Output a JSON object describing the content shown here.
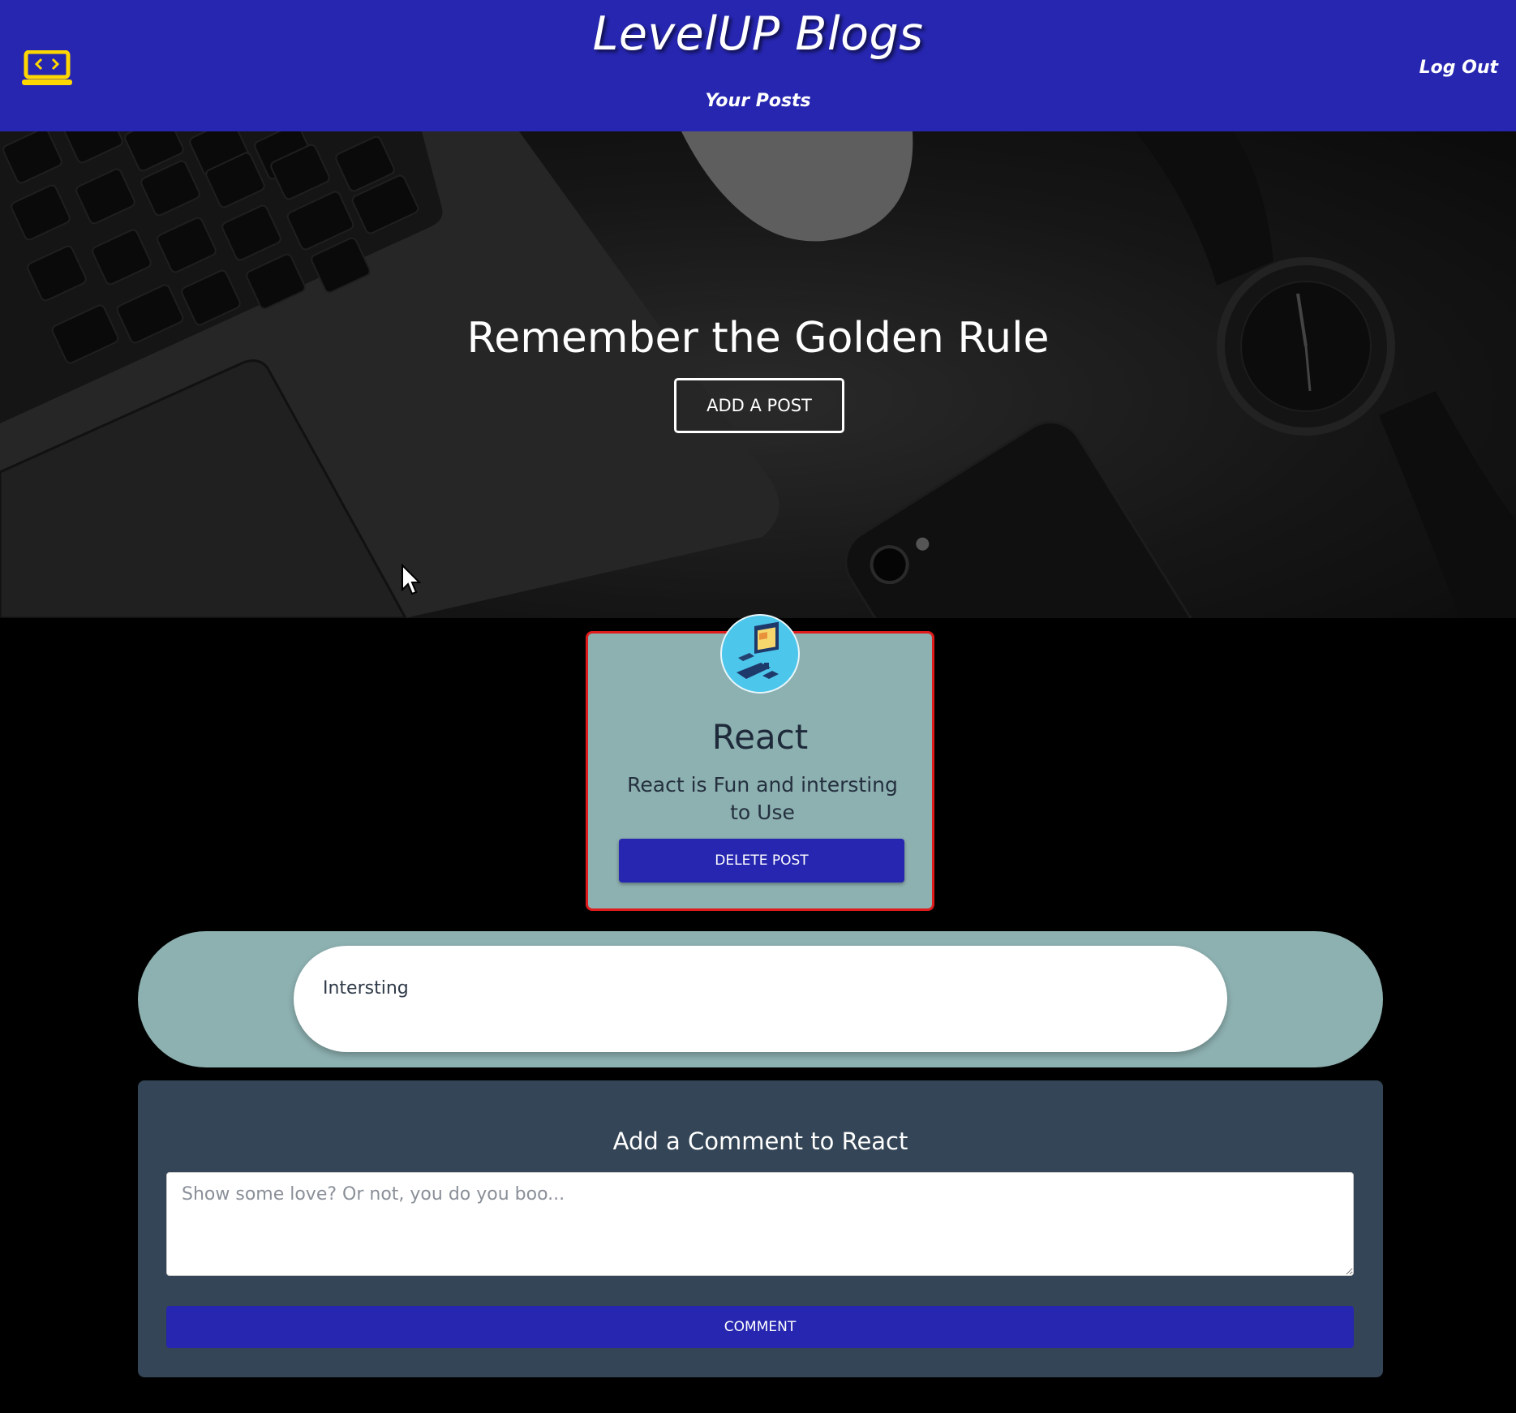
{
  "navbar": {
    "logo_icon": "laptop-code-icon",
    "brand": "LevelUP Blogs",
    "your_posts_link": "Your Posts",
    "logout_link": "Log Out",
    "colors": {
      "background": "#2626b0",
      "logo": "#ffd700"
    }
  },
  "hero": {
    "title": "Remember the Golden Rule",
    "add_post_button": "ADD A POST",
    "background_image": "dark desk with laptop keyboard, mouse, watch and phone"
  },
  "post": {
    "avatar_icon": "computer-desk-icon",
    "title": "React",
    "body": "React is Fun and intersting to Use",
    "delete_button": "DELETE POST",
    "colors": {
      "card": "#8db0b0",
      "border": "#e01b1b"
    }
  },
  "comments": [
    {
      "text": "Intersting"
    }
  ],
  "add_comment": {
    "title": "Add a Comment to React",
    "placeholder": "Show some love? Or not, you do you boo...",
    "value": "",
    "submit_button": "COMMENT",
    "colors": {
      "panel": "#334556",
      "button": "#2626b0"
    }
  }
}
